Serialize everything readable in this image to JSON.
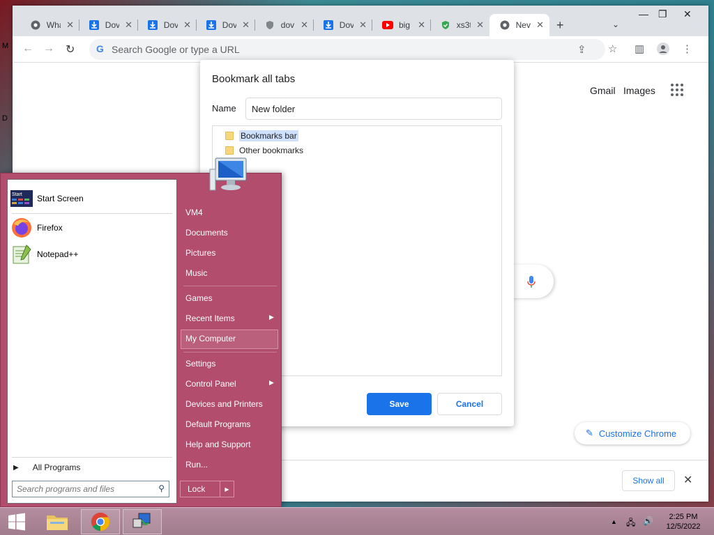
{
  "browser": {
    "tabs": [
      {
        "icon": "chrome-icon",
        "label": "Wha"
      },
      {
        "icon": "download-icon",
        "label": "Dov"
      },
      {
        "icon": "download-icon",
        "label": "Dov"
      },
      {
        "icon": "download-icon",
        "label": "Dov"
      },
      {
        "icon": "shield-icon",
        "label": "dov"
      },
      {
        "icon": "download-icon",
        "label": "Dov"
      },
      {
        "icon": "youtube-icon",
        "label": "big"
      },
      {
        "icon": "shield-check-icon",
        "label": "xs3t"
      },
      {
        "icon": "chrome-icon",
        "label": "Nev"
      }
    ],
    "omnibox_placeholder": "Search Google or type a URL",
    "ntp": {
      "gmail": "Gmail",
      "images": "Images",
      "customize": "Customize Chrome"
    },
    "downloads_bar": {
      "show_all": "Show all"
    }
  },
  "dialog": {
    "title": "Bookmark all tabs",
    "name_label": "Name",
    "name_value": "New folder",
    "folders": [
      "Bookmarks bar",
      "Other bookmarks"
    ],
    "save": "Save",
    "cancel": "Cancel"
  },
  "start_menu": {
    "left_items": [
      {
        "label": "Start Screen",
        "icon": "start-screen-icon"
      },
      {
        "label": "Firefox",
        "icon": "firefox-icon"
      },
      {
        "label": "Notepad++",
        "icon": "notepadpp-icon"
      }
    ],
    "all_programs": "All Programs",
    "search_placeholder": "Search programs and files",
    "right_items": [
      "VM4",
      "Documents",
      "Pictures",
      "Music",
      "Games",
      "Recent Items",
      "My Computer",
      "Settings",
      "Control Panel",
      "Devices and Printers",
      "Default Programs",
      "Help and Support",
      "Run..."
    ],
    "lock": "Lock",
    "start_tile_text": "Start"
  },
  "taskbar": {
    "time": "2:25 PM",
    "date": "12/5/2022"
  },
  "desktop_text": {
    "m": "M",
    "d": "D"
  },
  "colors": {
    "accent_blue": "#1a73e8",
    "start_menu_bg": "#b34d6e"
  }
}
